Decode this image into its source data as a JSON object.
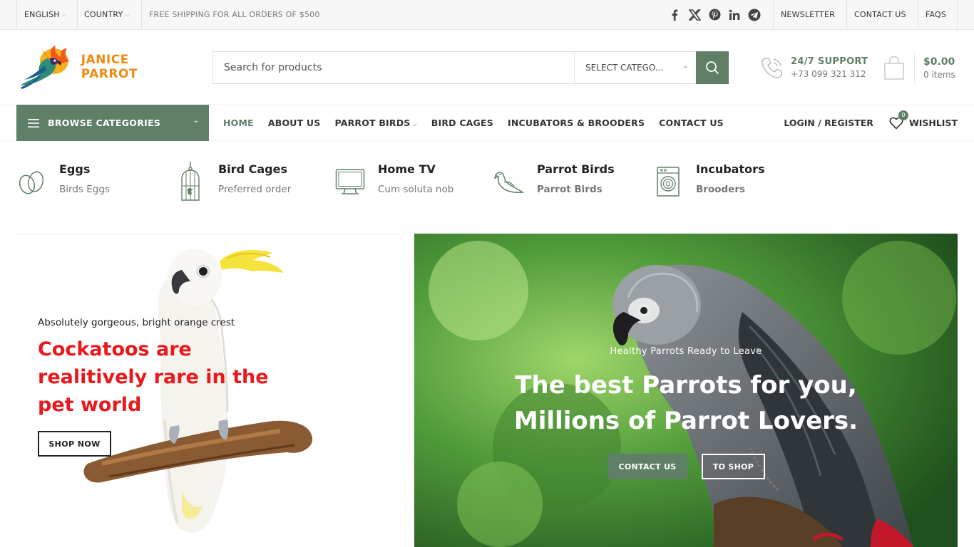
{
  "topbar": {
    "language": "ENGLISH",
    "country": "COUNTRY",
    "shipping": "FREE SHIPPING FOR ALL ORDERS OF $500",
    "links": [
      "NEWSLETTER",
      "CONTACT US",
      "FAQS"
    ],
    "social_icons": [
      "facebook-icon",
      "x-icon",
      "pinterest-icon",
      "linkedin-icon",
      "telegram-icon"
    ]
  },
  "header": {
    "logo_text": "JANICE PARROT",
    "search_placeholder": "Search for products",
    "category_select": "SELECT CATEGO...",
    "support_title": "24/7 SUPPORT",
    "support_phone": "+73 099 321 312",
    "cart_total": "$0.00",
    "cart_items": "0 items"
  },
  "nav": {
    "browse": "BROWSE CATEGORIES",
    "menu": [
      "HOME",
      "ABOUT US",
      "PARROT BIRDS",
      "BIRD CAGES",
      "INCUBATORS & BROODERS",
      "CONTACT US"
    ],
    "login": "LOGIN / REGISTER",
    "wishlist_count": "0",
    "wishlist": "WISHLIST"
  },
  "categories": [
    {
      "title": "Eggs",
      "subtitle": "Birds Eggs",
      "icon": "egg-icon"
    },
    {
      "title": "Bird Cages",
      "subtitle": "Preferred order",
      "icon": "cage-icon"
    },
    {
      "title": "Home TV",
      "subtitle": "Cum soluta nob",
      "icon": "monitor-icon"
    },
    {
      "title": "Parrot Birds",
      "subtitle": "Parrot Birds",
      "icon": "bird-icon"
    },
    {
      "title": "Incubators",
      "subtitle": "Brooders",
      "icon": "incubator-icon"
    }
  ],
  "hero_left": {
    "subtitle": "Absolutely gorgeous, bright orange crest",
    "title": "Cockatoos are realitively rare in the pet world",
    "button": "SHOP NOW"
  },
  "hero_right": {
    "subtitle": "Healthy Parrots Ready to Leave",
    "title_line1": "The best Parrots for you,",
    "title_line2": "Millions of Parrot Lovers.",
    "button_primary": "CONTACT US",
    "button_secondary": "TO SHOP"
  },
  "colors": {
    "accent": "#5f7f66",
    "hero_title_red": "#e8191c",
    "logo_orange": "#f08a14"
  }
}
